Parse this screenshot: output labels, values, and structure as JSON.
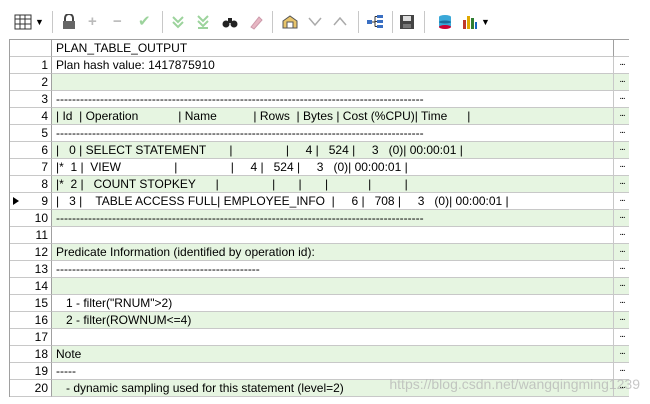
{
  "toolbar": {
    "icons": [
      "grid-view-icon",
      "lock-icon",
      "add-record-icon",
      "delete-record-icon",
      "post-edit-icon",
      "fetch-next-icon",
      "fetch-last-icon",
      "query-by-example-icon",
      "clear-record-icon",
      "single-record-view-icon",
      "sort-descending-icon",
      "sort-ascending-icon",
      "explain-plan-icon",
      "save-icon",
      "export-icon",
      "chart-icon"
    ]
  },
  "grid": {
    "column_header": "PLAN_TABLE_OUTPUT",
    "rows": [
      {
        "n": "1",
        "text": "Plan hash value: 1417875910"
      },
      {
        "n": "2",
        "text": ""
      },
      {
        "n": "3",
        "text": "--------------------------------------------------------------------------------------------"
      },
      {
        "n": "4",
        "text": "| Id  | Operation            | Name           | Rows  | Bytes | Cost (%CPU)| Time      |"
      },
      {
        "n": "5",
        "text": "--------------------------------------------------------------------------------------------"
      },
      {
        "n": "6",
        "text": "|   0 | SELECT STATEMENT       |                |     4 |   524 |     3   (0)| 00:00:01 |"
      },
      {
        "n": "7",
        "text": "|*  1 |  VIEW                |                |     4 |   524 |     3   (0)| 00:00:01 |"
      },
      {
        "n": "8",
        "text": "|*  2 |   COUNT STOPKEY      |                |       |       |            |          |"
      },
      {
        "n": "9",
        "text": "|   3 |    TABLE ACCESS FULL| EMPLOYEE_INFO  |     6 |   708 |     3   (0)| 00:00:01 |"
      },
      {
        "n": "10",
        "text": "--------------------------------------------------------------------------------------------"
      },
      {
        "n": "11",
        "text": ""
      },
      {
        "n": "12",
        "text": "Predicate Information (identified by operation id):"
      },
      {
        "n": "13",
        "text": "---------------------------------------------------"
      },
      {
        "n": "14",
        "text": ""
      },
      {
        "n": "15",
        "text": "   1 - filter(\"RNUM\">2)"
      },
      {
        "n": "16",
        "text": "   2 - filter(ROWNUM<=4)"
      },
      {
        "n": "17",
        "text": ""
      },
      {
        "n": "18",
        "text": "Note"
      },
      {
        "n": "19",
        "text": "-----"
      },
      {
        "n": "20",
        "text": "   - dynamic sampling used for this statement (level=2)"
      }
    ],
    "ellipsis": "...",
    "current_row": "9"
  },
  "watermark": "https://blog.csdn.net/wangqingming1239",
  "colors": {
    "row_alt": "#e6f5e1",
    "grid_line": "#c8c8c8"
  }
}
